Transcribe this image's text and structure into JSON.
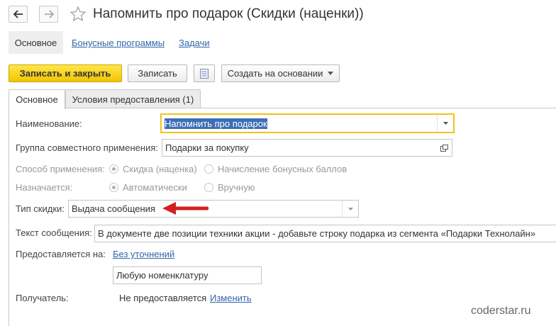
{
  "window": {
    "title": "Напомнить про подарок (Скидки (наценки))"
  },
  "nav_tabs": {
    "current": "Основное",
    "bonus": "Бонусные программы",
    "tasks": "Задачи"
  },
  "toolbar": {
    "save_close": "Записать и закрыть",
    "save": "Записать",
    "create_based": "Создать на основании"
  },
  "form_tabs": {
    "main": "Основное",
    "conditions": "Условия предоставления (1)"
  },
  "form": {
    "name_label": "Наименование:",
    "name_value": "Напомнить про подарок",
    "group_label": "Группа совместного применения:",
    "group_value": "Подарки за покупку",
    "method_label": "Способ применения:",
    "method_opt1": "Скидка (наценка)",
    "method_opt2": "Начисление бонусных баллов",
    "assign_label": "Назначается:",
    "assign_opt1": "Автоматически",
    "assign_opt2": "Вручную",
    "type_label": "Тип скидки:",
    "type_value": "Выдача сообщения",
    "message_label": "Текст сообщения:",
    "message_value": "В документе две позиции техники акции - добавьте строку подарка из сегмента «Подарки Технолайн»",
    "provided_label": "Предоставляется на:",
    "provided_link": "Без уточнений",
    "nomenclature_value": "Любую номенклатуру",
    "recipient_label": "Получатель:",
    "recipient_value": "Не предоставляется",
    "recipient_change": "Изменить"
  },
  "watermark": "coderstar.ru",
  "colors": {
    "primary_button": "#f2c500",
    "link": "#3366aa",
    "focus_border": "#f0c419",
    "selection": "#3d6fb6",
    "arrow": "#d42020"
  }
}
